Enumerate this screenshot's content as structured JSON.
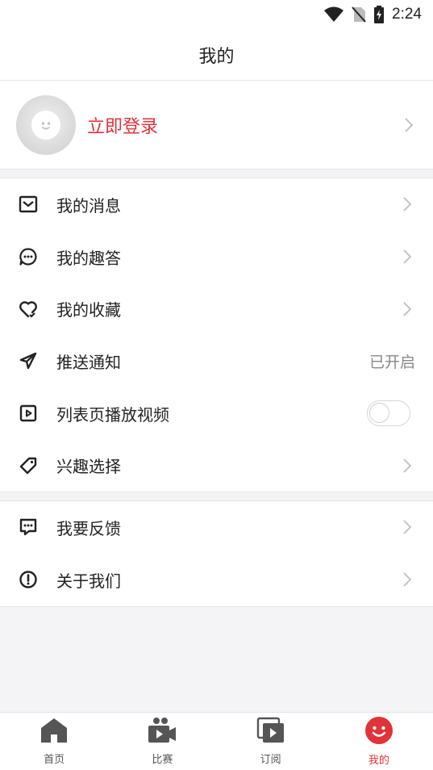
{
  "status_bar": {
    "time": "2:24"
  },
  "header": {
    "title": "我的"
  },
  "profile": {
    "login_label": "立即登录"
  },
  "menu_group_1": [
    {
      "label": "我的消息",
      "icon": "mail-icon"
    },
    {
      "label": "我的趣答",
      "icon": "chat-dots-icon"
    },
    {
      "label": "我的收藏",
      "icon": "heart-icon"
    },
    {
      "label": "推送通知",
      "icon": "send-icon",
      "value": "已开启"
    },
    {
      "label": "列表页播放视频",
      "icon": "video-play-icon",
      "toggle": false
    },
    {
      "label": "兴趣选择",
      "icon": "tag-icon"
    }
  ],
  "menu_group_2": [
    {
      "label": "我要反馈",
      "icon": "feedback-icon"
    },
    {
      "label": "关于我们",
      "icon": "info-icon"
    }
  ],
  "tabbar": {
    "items": [
      {
        "label": "首页",
        "icon": "home-icon"
      },
      {
        "label": "比赛",
        "icon": "video-camera-icon"
      },
      {
        "label": "订阅",
        "icon": "subscribe-icon"
      },
      {
        "label": "我的",
        "icon": "smiley-icon",
        "active": true
      }
    ]
  },
  "colors": {
    "accent": "#e0333a",
    "text": "#222222",
    "muted": "#888888",
    "background": "#f4f4f6"
  }
}
